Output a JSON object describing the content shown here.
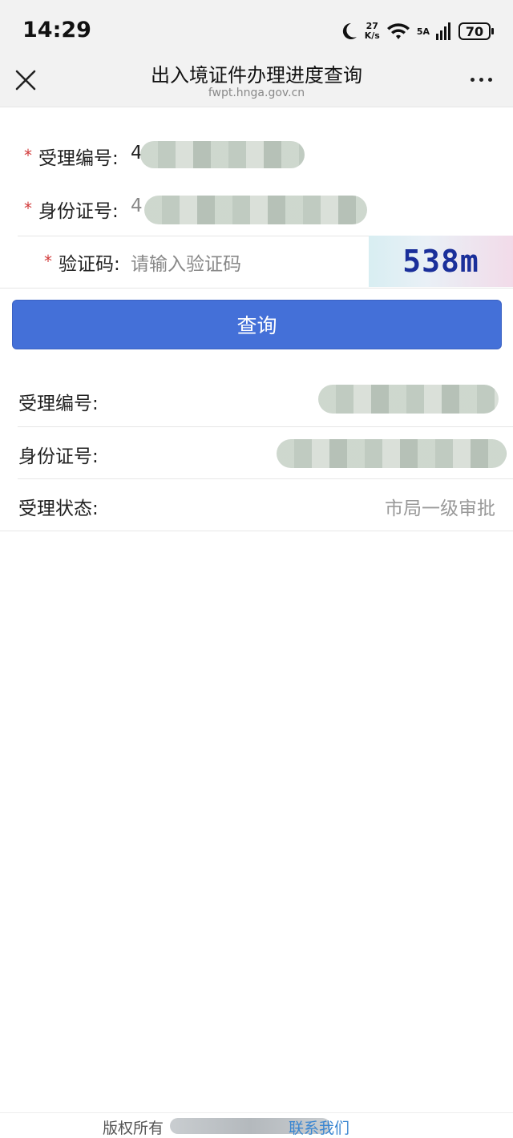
{
  "status_bar": {
    "time": "14:29",
    "net_speed_value": "27",
    "net_speed_unit": "K/s",
    "signal_label": "5A",
    "battery": "70"
  },
  "nav": {
    "title": "出入境证件办理进度查询",
    "url": "fwpt.hnga.gov.cn"
  },
  "form": {
    "required_mark": "*",
    "accept_no_label": "受理编号:",
    "accept_no_visible_prefix": "4",
    "id_no_label": "身份证号:",
    "id_no_visible_prefix": "4",
    "captcha_label": "验证码:",
    "captcha_placeholder": "请输入验证码",
    "captcha_text": "538m"
  },
  "query_button": "查询",
  "result": {
    "accept_no_label": "受理编号:",
    "id_no_label": "身份证号:",
    "status_label": "受理状态:",
    "status_value": "市局一级审批"
  },
  "footer": {
    "copyright": "版权所有",
    "contact": "联系我们"
  },
  "colors": {
    "accent": "#4470d8",
    "required": "#d23b3b",
    "link": "#3a86d1"
  }
}
